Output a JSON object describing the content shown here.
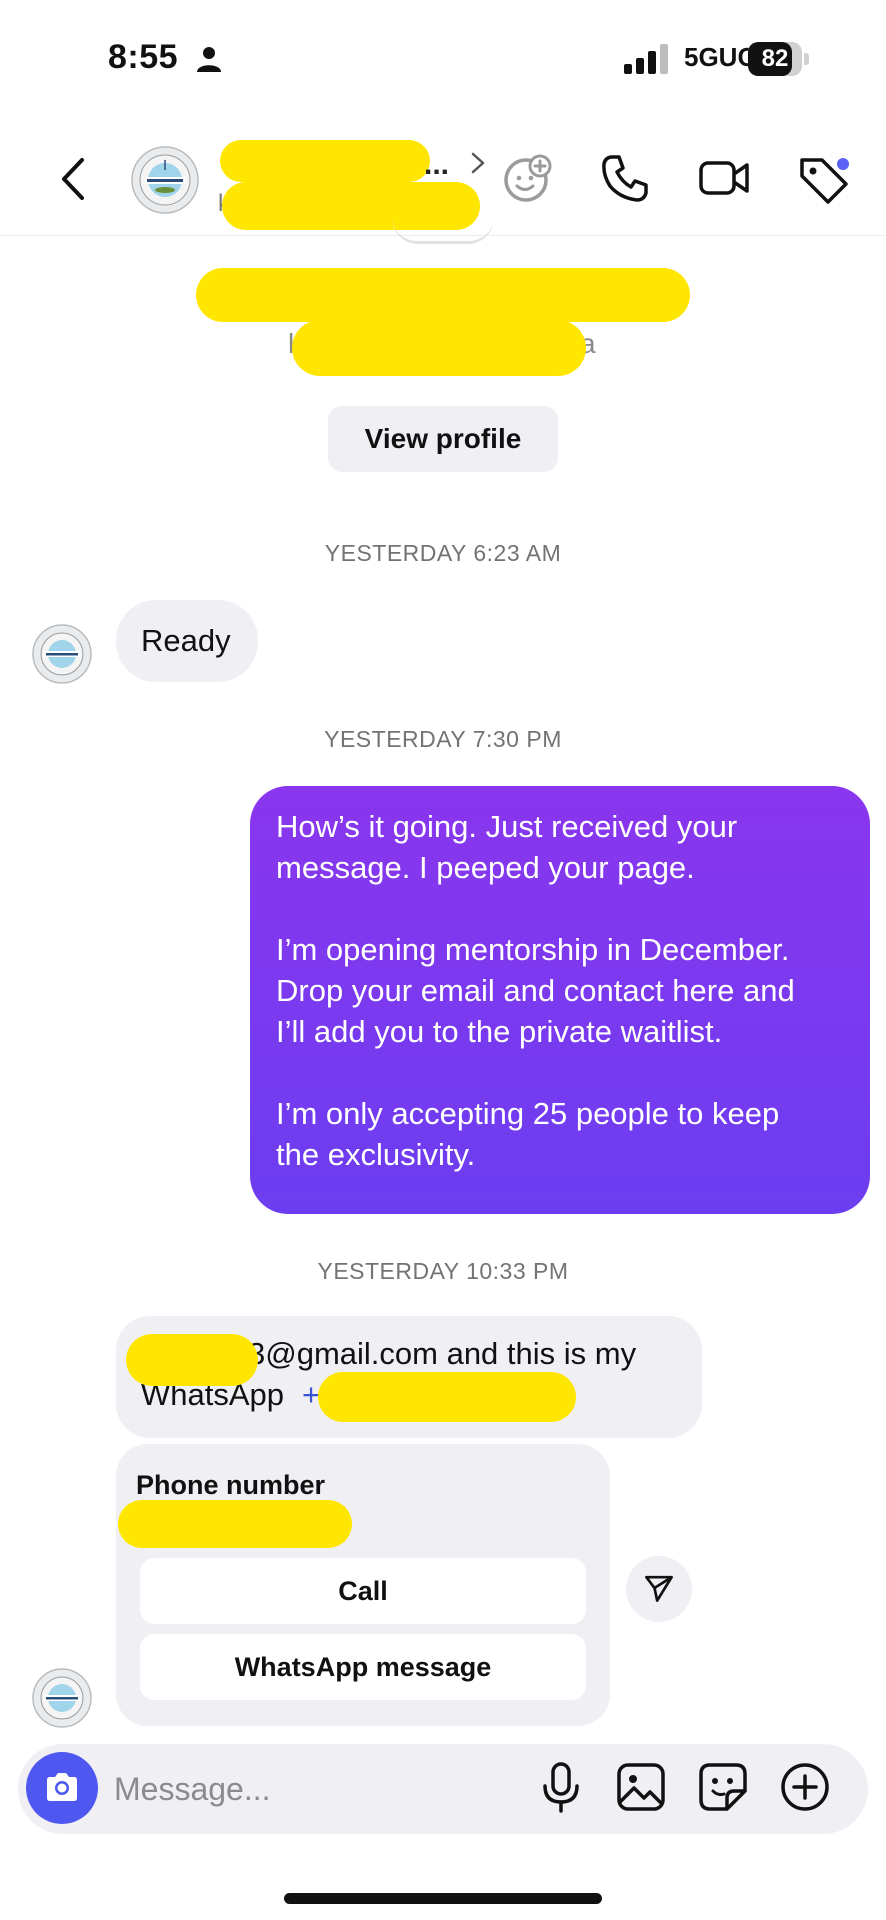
{
  "status_bar": {
    "time": "8:55",
    "network": "5GUC",
    "battery_level": 82,
    "battery_text": "82"
  },
  "header": {
    "name_suffix": "...",
    "username_prefix": "k"
  },
  "profile": {
    "username_prefix": "k",
    "username_suffix": "a",
    "view_profile_label": "View profile"
  },
  "messages": [
    {
      "timestamp": "YESTERDAY 6:23 AM",
      "direction": "incoming",
      "text": "Ready"
    },
    {
      "timestamp": "YESTERDAY 7:30 PM",
      "direction": "outgoing",
      "paragraphs": [
        [
          "How’s it going. Just received your",
          "message. I peeped your page."
        ],
        [
          "I’m opening mentorship in December.",
          "Drop your email and contact here and",
          "I’ll add you to the private waitlist."
        ],
        [
          "I’m only accepting 25 people to keep",
          "the exclusivity."
        ]
      ]
    },
    {
      "timestamp": "YESTERDAY 10:33 PM",
      "direction": "incoming",
      "line1_visible": "3@gmail.com and this is my",
      "line2_label": "WhatsApp",
      "line2_visible": "+"
    }
  ],
  "phone_card": {
    "title": "Phone number",
    "call_label": "Call",
    "whatsapp_label": "WhatsApp message"
  },
  "composer": {
    "placeholder": "Message..."
  },
  "colors": {
    "accent": "#5b63f6",
    "bubble_gradient_top": "#8a36ee",
    "bubble_gradient_bottom": "#6c3df0",
    "incoming_bubble": "#efeff4",
    "redaction": "#ffe600"
  },
  "icons": [
    "person-icon",
    "signal-icon",
    "battery-icon",
    "back-icon",
    "chevron-right-icon",
    "effects-icon",
    "phone-icon",
    "video-icon",
    "tag-icon",
    "send-icon",
    "camera-icon",
    "microphone-icon",
    "gallery-icon",
    "sticker-icon",
    "add-icon"
  ]
}
